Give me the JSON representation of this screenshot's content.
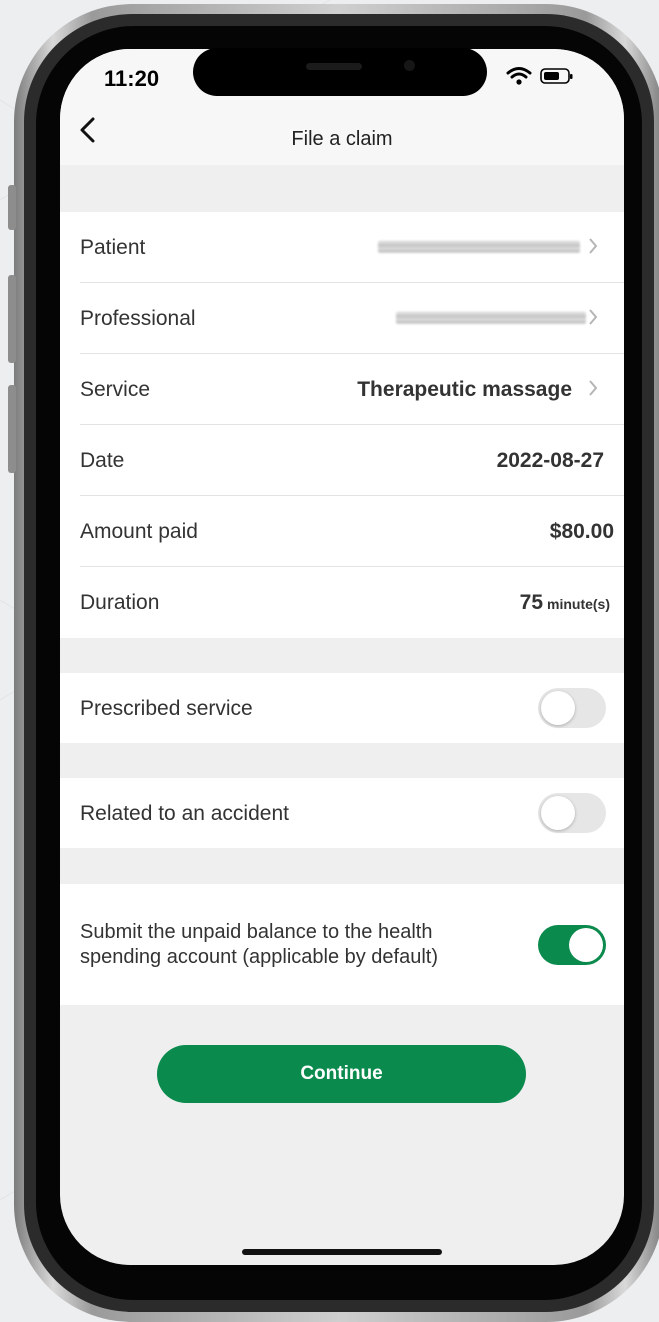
{
  "status_bar": {
    "time": "11:20"
  },
  "header": {
    "title": "File a claim"
  },
  "claim_details": [
    {
      "label": "Patient",
      "value": ""
    },
    {
      "label": "Professional",
      "value": ""
    },
    {
      "label": "Service",
      "value": "Therapeutic massage"
    },
    {
      "label": "Date",
      "value": "2022-08-27"
    },
    {
      "label": "Amount paid",
      "value": "$80.00"
    },
    {
      "label": "Duration",
      "value": "75",
      "unit": "minute(s)"
    }
  ],
  "toggles": [
    {
      "label": "Prescribed service",
      "on": false
    },
    {
      "label": "Related to an accident",
      "on": false
    },
    {
      "label": "Submit the unpaid balance to the health spending account (applicable by default)",
      "on": true
    }
  ],
  "continue_label": "Continue",
  "colors": {
    "accent": "#0a8a4d",
    "background": "#efefef"
  },
  "icons": [
    "back-chevron-icon",
    "chevron-right-icon",
    "wifi-icon",
    "battery-icon"
  ]
}
